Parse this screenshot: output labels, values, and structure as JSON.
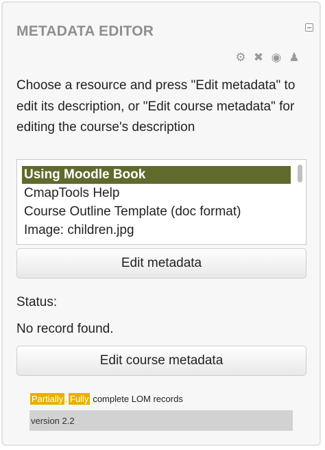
{
  "block": {
    "title": "METADATA EDITOR",
    "icons": [
      "gear-icon",
      "close-icon",
      "eye-icon",
      "assign-user-icon"
    ]
  },
  "instructions": "Choose a resource and press \"Edit metadata\" to edit its description, or \"Edit course metadata\" for editing the course's description",
  "resources": {
    "items": [
      "Using Moodle Book",
      "CmapTools Help",
      "Course Outline Template (doc format)",
      "Image: children.jpg"
    ],
    "selected_index": 0
  },
  "buttons": {
    "edit_metadata": "Edit metadata",
    "edit_course_metadata": "Edit course metadata"
  },
  "status": {
    "label": "Status:",
    "value": "No record found."
  },
  "legend": {
    "partially": "Partially",
    "separator": ",",
    "fully": "Fully",
    "text": "complete LOM records"
  },
  "version": "version 2.2",
  "colors": {
    "selection": "#5e6b2c",
    "legend_tag": "#e8b000",
    "title": "#8f8f8f"
  }
}
